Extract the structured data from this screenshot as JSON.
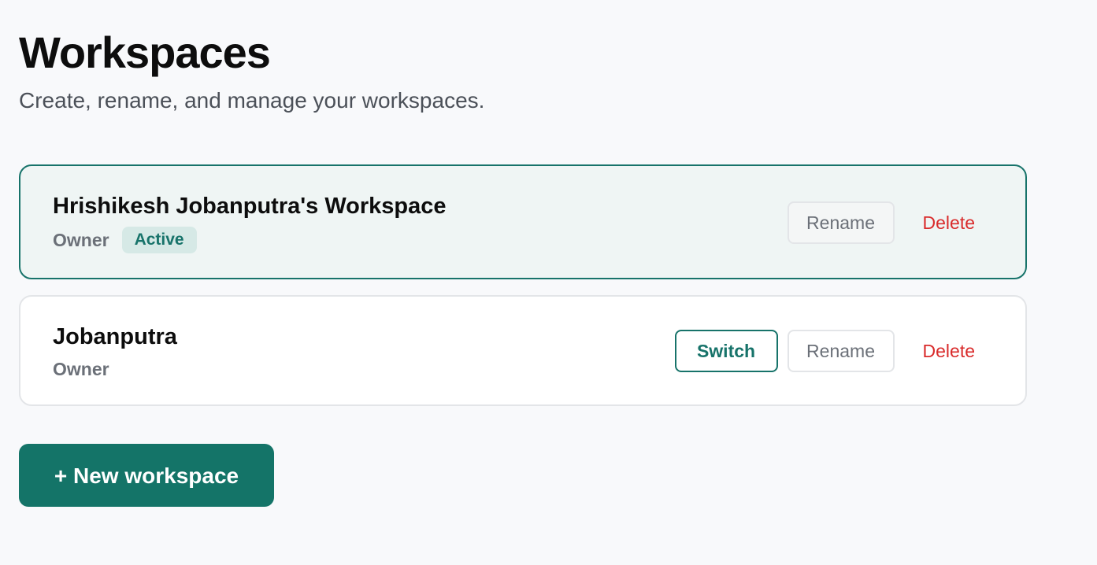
{
  "header": {
    "title": "Workspaces",
    "subtitle": "Create, rename, and manage your workspaces."
  },
  "workspaces": [
    {
      "name": "Hrishikesh Jobanputra's Workspace",
      "role": "Owner",
      "status_badge": "Active",
      "is_active": true,
      "actions": {
        "rename_label": "Rename",
        "delete_label": "Delete"
      }
    },
    {
      "name": "Jobanputra",
      "role": "Owner",
      "is_active": false,
      "actions": {
        "switch_label": "Switch",
        "rename_label": "Rename",
        "delete_label": "Delete"
      }
    }
  ],
  "footer": {
    "new_workspace_label": "+ New workspace"
  },
  "colors": {
    "accent": "#147468",
    "active_card_bg": "#eff5f4",
    "badge_bg": "#d6e9e6",
    "danger": "#d92b2b",
    "muted_text": "#6b7078",
    "page_bg": "#f8f9fb"
  }
}
